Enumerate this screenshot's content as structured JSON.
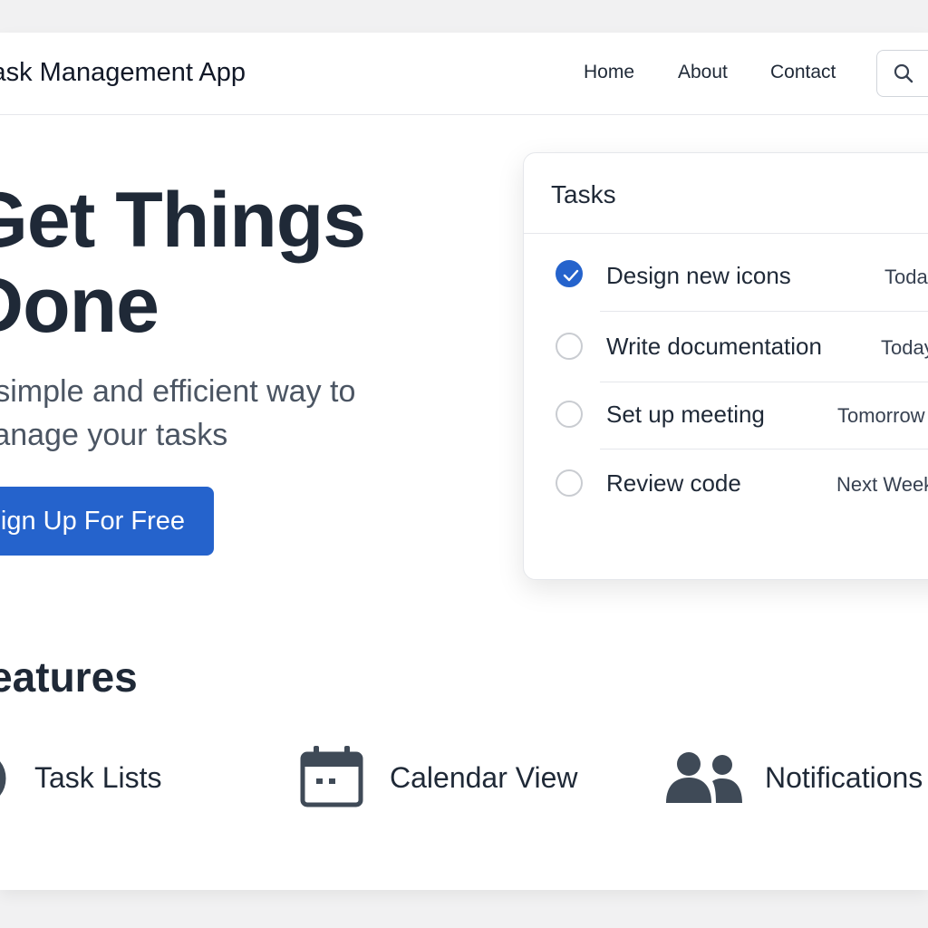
{
  "app": {
    "title": "Task Management App"
  },
  "nav": {
    "home": "Home",
    "about": "About",
    "contact": "Contact"
  },
  "hero": {
    "title_line1": "Get Things",
    "title_line2": "Done",
    "subtitle_line1": "A simple and efficient way to",
    "subtitle_line2": "manage your tasks",
    "cta_label": "Sign Up For Free"
  },
  "tasks_card": {
    "title": "Tasks",
    "items": [
      {
        "name": "Design new icons",
        "due": "Today",
        "done": true
      },
      {
        "name": "Write documentation",
        "due": "Today",
        "done": false
      },
      {
        "name": "Set up meeting",
        "due": "Tomorrow",
        "done": false
      },
      {
        "name": "Review code",
        "due": "Next Week",
        "done": false
      }
    ]
  },
  "features": {
    "title": "Features",
    "items": [
      {
        "label": "Task Lists",
        "icon": "task-list-icon"
      },
      {
        "label": "Calendar View",
        "icon": "calendar-icon"
      },
      {
        "label": "Notifications",
        "icon": "users-icon"
      }
    ]
  },
  "colors": {
    "accent": "#2563cc",
    "text": "#1f2937",
    "muted": "#4b5563",
    "border": "#e5e7eb"
  }
}
